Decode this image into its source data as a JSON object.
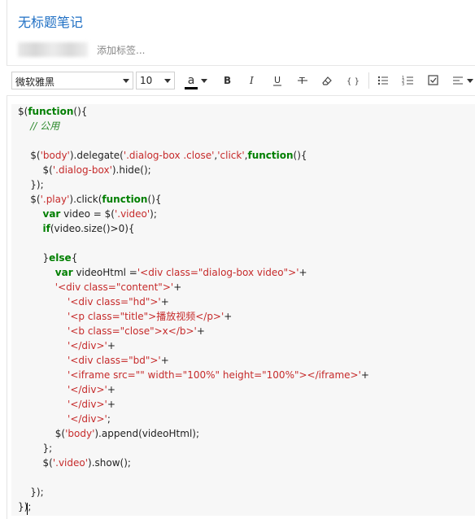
{
  "note": {
    "title": "无标题笔记",
    "add_tag": "添加标签..."
  },
  "toolbar": {
    "font": "微软雅黑",
    "size": "10",
    "color_glyph": "a",
    "code_glyph": "{ }"
  },
  "colors": {
    "title": "#1e6fc4",
    "keyword": "#007f00",
    "string": "#c62b2b",
    "comment": "#2e8a2e",
    "editor_bg": "#f7f7f7"
  },
  "code_lines": [
    [
      [
        "p",
        "$("
      ],
      [
        "k",
        "function"
      ],
      [
        "p",
        "(){"
      ]
    ],
    [
      [
        "p",
        "    "
      ],
      [
        "c",
        "// 公用"
      ]
    ],
    [],
    [
      [
        "p",
        "    $("
      ],
      [
        "s",
        "'body'"
      ],
      [
        "p",
        ").delegate("
      ],
      [
        "s",
        "'.dialog-box .close'"
      ],
      [
        "p",
        ","
      ],
      [
        "s",
        "'click'"
      ],
      [
        "p",
        ","
      ],
      [
        "k",
        "function"
      ],
      [
        "p",
        "(){"
      ]
    ],
    [
      [
        "p",
        "        $("
      ],
      [
        "s",
        "'.dialog-box'"
      ],
      [
        "p",
        ").hide();"
      ]
    ],
    [
      [
        "p",
        "    });"
      ]
    ],
    [
      [
        "p",
        "    $("
      ],
      [
        "s",
        "'.play'"
      ],
      [
        "p",
        ").click("
      ],
      [
        "k",
        "function"
      ],
      [
        "p",
        "(){"
      ]
    ],
    [
      [
        "p",
        "        "
      ],
      [
        "k",
        "var"
      ],
      [
        "p",
        " video = $("
      ],
      [
        "s",
        "'.video'"
      ],
      [
        "p",
        ");"
      ]
    ],
    [
      [
        "p",
        "        "
      ],
      [
        "k",
        "if"
      ],
      [
        "p",
        "(video.size()>0){"
      ]
    ],
    [],
    [
      [
        "p",
        "        }"
      ],
      [
        "k",
        "else"
      ],
      [
        "p",
        "{"
      ]
    ],
    [
      [
        "p",
        "            "
      ],
      [
        "k",
        "var"
      ],
      [
        "p",
        " videoHtml ="
      ],
      [
        "s",
        "'<div class=\"dialog-box video\">'"
      ],
      [
        "p",
        "+"
      ]
    ],
    [
      [
        "p",
        "            "
      ],
      [
        "s",
        "'<div class=\"content\">'"
      ],
      [
        "p",
        "+"
      ]
    ],
    [
      [
        "p",
        "                "
      ],
      [
        "s",
        "'<div class=\"hd\">'"
      ],
      [
        "p",
        "+"
      ]
    ],
    [
      [
        "p",
        "                "
      ],
      [
        "s",
        "'<p class=\"title\">播放视频</p>'"
      ],
      [
        "p",
        "+"
      ]
    ],
    [
      [
        "p",
        "                "
      ],
      [
        "s",
        "'<b class=\"close\">x</b>'"
      ],
      [
        "p",
        "+"
      ]
    ],
    [
      [
        "p",
        "                "
      ],
      [
        "s",
        "'</div>'"
      ],
      [
        "p",
        "+"
      ]
    ],
    [
      [
        "p",
        "                "
      ],
      [
        "s",
        "'<div class=\"bd\">'"
      ],
      [
        "p",
        "+"
      ]
    ],
    [
      [
        "p",
        "                "
      ],
      [
        "s",
        "'<iframe src=\"\" width=\"100%\" height=\"100%\"></iframe>'"
      ],
      [
        "p",
        "+"
      ]
    ],
    [
      [
        "p",
        "                "
      ],
      [
        "s",
        "'</div>'"
      ],
      [
        "p",
        "+"
      ]
    ],
    [
      [
        "p",
        "                "
      ],
      [
        "s",
        "'</div>'"
      ],
      [
        "p",
        "+"
      ]
    ],
    [
      [
        "p",
        "                "
      ],
      [
        "s",
        "'</div>'"
      ],
      [
        "p",
        ";"
      ]
    ],
    [
      [
        "p",
        "            $("
      ],
      [
        "s",
        "'body'"
      ],
      [
        "p",
        ").append(videoHtml);"
      ]
    ],
    [
      [
        "p",
        "        };"
      ]
    ],
    [
      [
        "p",
        "        $("
      ],
      [
        "s",
        "'.video'"
      ],
      [
        "p",
        ").show();"
      ]
    ],
    [],
    [
      [
        "p",
        "    });"
      ]
    ],
    [
      [
        "p",
        "});"
      ]
    ]
  ]
}
